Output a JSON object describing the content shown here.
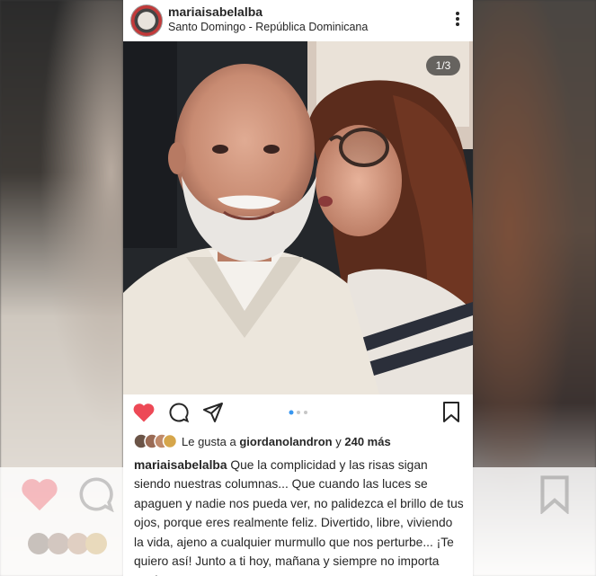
{
  "post": {
    "username": "mariaisabelalba",
    "location": "Santo Domingo - República Dominicana",
    "photo_counter": "1/3",
    "carousel_index": 1,
    "carousel_total": 3
  },
  "likes": {
    "prefix": "Le gusta a",
    "user": "giordanolandron",
    "joiner": "y",
    "more": "240 más"
  },
  "caption": {
    "username": "mariaisabelalba",
    "text": "Que la complicidad y las risas sigan siendo nuestras columnas... Que cuando las luces se apaguen y nadie nos pueda ver, no palidezca el brillo de tus ojos, porque eres realmente feliz. Divertido, libre, viviendo la vida, ajeno a cualquier murmullo que nos perturbe... ¡Te quiero así! Junto a ti hoy, mañana y siempre no importa que!"
  },
  "colors": {
    "heart": "#ed4956",
    "dot_active": "#3897f0",
    "dot_inactive": "#c7c7c7",
    "text": "#262626"
  },
  "icons": [
    "more-icon",
    "heart-icon",
    "comment-icon",
    "share-icon",
    "bookmark-icon"
  ]
}
